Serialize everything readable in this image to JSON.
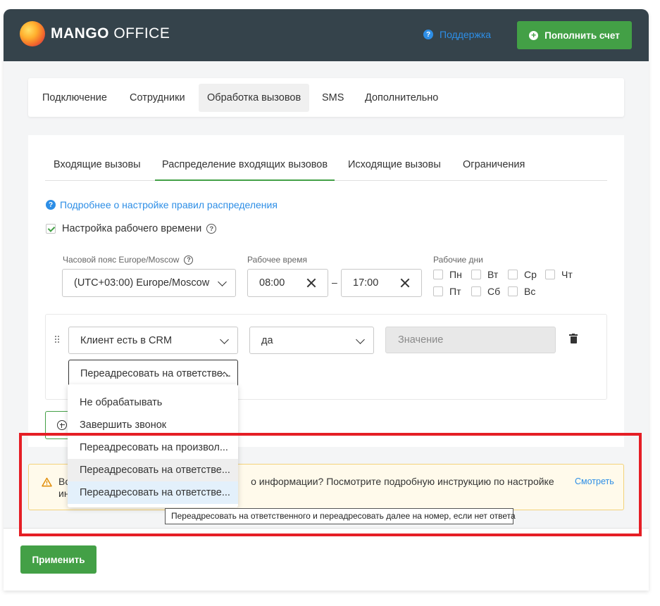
{
  "header": {
    "logo_bold": "MANGO",
    "logo_light": "OFFICE",
    "support_label": "Поддержка",
    "topup_label": "Пополнить счет"
  },
  "main_tabs": [
    {
      "label": "Подключение"
    },
    {
      "label": "Сотрудники"
    },
    {
      "label": "Обработка вызовов",
      "active": true
    },
    {
      "label": "SMS"
    },
    {
      "label": "Дополнительно"
    }
  ],
  "sub_tabs": [
    {
      "label": "Входящие вызовы"
    },
    {
      "label": "Распределение входящих вызовов",
      "active": true
    },
    {
      "label": "Исходящие вызовы"
    },
    {
      "label": "Ограничения"
    }
  ],
  "info_link": "Подробнее о настройке правил распределения",
  "work_time": {
    "checkbox_label": "Настройка рабочего времени",
    "checked": true,
    "timezone_label": "Часовой пояс Europe/Moscow",
    "timezone_value": "(UTC+03:00) Europe/Moscow",
    "hours_label": "Рабочее время",
    "from": "08:00",
    "separator": "–",
    "to": "17:00",
    "days_label": "Рабочие дни",
    "days": [
      "Пн",
      "Вт",
      "Ср",
      "Чт",
      "Пт",
      "Сб",
      "Вс"
    ]
  },
  "rule": {
    "condition": "Клиент есть в CRM",
    "operator": "да",
    "value_placeholder": "Значение",
    "action": "Переадресовать на ответстве..."
  },
  "dropdown": {
    "options": [
      "Не обрабатывать",
      "Завершить звонок",
      "Переадресовать на произвол...",
      "Переадресовать на ответстве...",
      "Переадресовать на ответстве..."
    ]
  },
  "warning": {
    "text_start": "Во",
    "text_mid": "о информации? Посмотрите подробную инструкцию по настройке",
    "text_line2": "ин",
    "link": "Смотреть"
  },
  "tooltip": "Переадресовать на ответственного и переадресовать далее на номер, если нет ответа",
  "footer": {
    "apply_label": "Применить"
  },
  "colors": {
    "header_bg": "#35434b",
    "accent_green": "#43a046",
    "link_blue": "#2d8ee6",
    "highlight_red": "#e51e25",
    "warning_bg": "#fffaeb"
  }
}
